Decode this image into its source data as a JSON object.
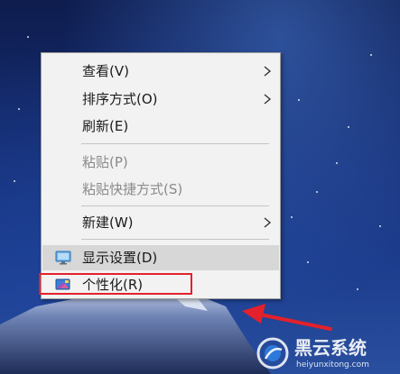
{
  "context_menu": {
    "items": [
      {
        "label": "查看(V)",
        "submenu": true,
        "disabled": false
      },
      {
        "label": "排序方式(O)",
        "submenu": true,
        "disabled": false
      },
      {
        "label": "刷新(E)",
        "submenu": false,
        "disabled": false
      },
      {
        "label": "粘贴(P)",
        "submenu": false,
        "disabled": true
      },
      {
        "label": "粘贴快捷方式(S)",
        "submenu": false,
        "disabled": true
      },
      {
        "label": "新建(W)",
        "submenu": true,
        "disabled": false
      },
      {
        "label": "显示设置(D)",
        "submenu": false,
        "disabled": false,
        "icon": "display-settings-icon"
      },
      {
        "label": "个性化(R)",
        "submenu": false,
        "disabled": false,
        "icon": "personalize-icon"
      }
    ]
  },
  "annotation": {
    "highlight_color": "#e3212b",
    "target": "个性化(R)"
  },
  "watermark": {
    "title": "黑云系统",
    "url": "heiyunxitong.com"
  },
  "colors": {
    "menu_background": "#f2f2f2",
    "menu_hover": "#d7d7d7",
    "disabled_text": "#8a8a8a",
    "annotation_red": "#e3212b"
  }
}
